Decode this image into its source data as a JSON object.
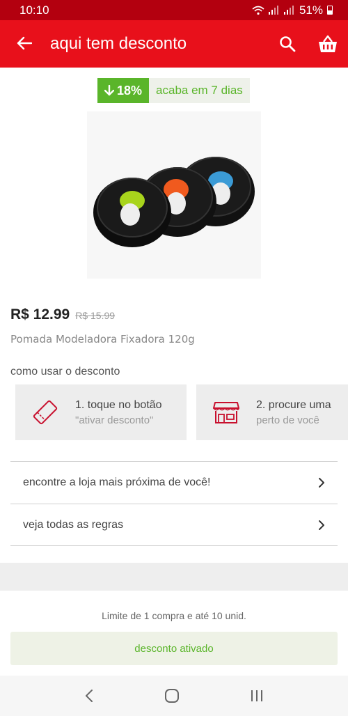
{
  "status_bar": {
    "time": "10:10",
    "battery": "51%"
  },
  "app_bar": {
    "title": "aqui tem desconto"
  },
  "badge": {
    "percent": "18%",
    "expires": "acaba em 7 dias"
  },
  "product": {
    "price_now": "R$ 12.99",
    "price_old": "R$ 15.99",
    "name": "Pomada Modeladora Fixadora 120g"
  },
  "how_to": {
    "title": "como usar o desconto",
    "steps": [
      {
        "title": "1. toque no botão",
        "subtitle": "\"ativar desconto\"",
        "icon": "ticket-icon"
      },
      {
        "title": "2. procure uma",
        "subtitle": "perto de você",
        "icon": "store-icon"
      }
    ]
  },
  "links": [
    {
      "label": "encontre a loja mais próxima de você!"
    },
    {
      "label": "veja todas as regras"
    }
  ],
  "limit_text": "Limite de 1 compra e até 10 unid.",
  "activate_button": "desconto ativado",
  "colors": {
    "brand_red": "#e8101b",
    "status_red": "#b3000f",
    "green": "#5ab52a"
  }
}
